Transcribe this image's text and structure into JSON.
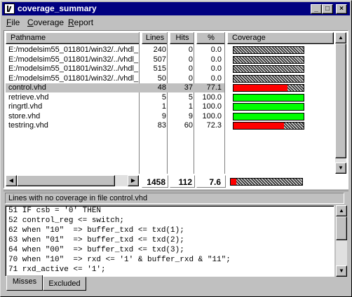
{
  "window": {
    "title": "coverage_summary"
  },
  "menu": [
    {
      "label": "File",
      "underline": "F",
      "rest": "ile"
    },
    {
      "label": "Coverage",
      "underline": "C",
      "rest": "overage"
    },
    {
      "label": "Report",
      "underline": "R",
      "rest": "eport"
    }
  ],
  "table": {
    "headers": {
      "pathname": "Pathname",
      "lines": "Lines",
      "hits": "Hits",
      "pct": "%",
      "coverage": "Coverage"
    },
    "rows": [
      {
        "path": "E:/modelsim55_011801/win32/../vhdl_",
        "lines": "240",
        "hits": "0",
        "pct": "0.0",
        "coverage": 0.0,
        "selected": false
      },
      {
        "path": "E:/modelsim55_011801/win32/../vhdl_",
        "lines": "507",
        "hits": "0",
        "pct": "0.0",
        "coverage": 0.0,
        "selected": false
      },
      {
        "path": "E:/modelsim55_011801/win32/../vhdl_",
        "lines": "515",
        "hits": "0",
        "pct": "0.0",
        "coverage": 0.0,
        "selected": false
      },
      {
        "path": "E:/modelsim55_011801/win32/../vhdl_",
        "lines": "50",
        "hits": "0",
        "pct": "0.0",
        "coverage": 0.0,
        "selected": false
      },
      {
        "path": "control.vhd",
        "lines": "48",
        "hits": "37",
        "pct": "77.1",
        "coverage": 77.1,
        "selected": true
      },
      {
        "path": "retrieve.vhd",
        "lines": "5",
        "hits": "5",
        "pct": "100.0",
        "coverage": 100.0,
        "selected": false
      },
      {
        "path": "ringrtl.vhd",
        "lines": "1",
        "hits": "1",
        "pct": "100.0",
        "coverage": 100.0,
        "selected": false
      },
      {
        "path": "store.vhd",
        "lines": "9",
        "hits": "9",
        "pct": "100.0",
        "coverage": 100.0,
        "selected": false
      },
      {
        "path": "testring.vhd",
        "lines": "83",
        "hits": "60",
        "pct": "72.3",
        "coverage": 72.3,
        "selected": false
      }
    ],
    "totals": {
      "lines": "1458",
      "hits": "112",
      "pct": "7.6",
      "coverage": 7.6
    }
  },
  "colors": {
    "full": "#00ff00",
    "partial": "#ff0000",
    "selection": "#c0c0c0",
    "titlebar": "#000080"
  },
  "bottom": {
    "title": "Lines with no coverage in file control.vhd",
    "lines": [
      "51 IF csb = '0' THEN",
      "52 control_reg <= switch;",
      "62 when \"10\"  => buffer_txd <= txd(1);",
      "63 when \"01\"  => buffer_txd <= txd(2);",
      "64 when \"00\"  => buffer_txd <= txd(3);",
      "70 when \"10\"  => rxd <= '1' & buffer_rxd & \"11\";",
      "71 rxd_active <= '1';"
    ]
  },
  "tabs": [
    {
      "label": "Misses",
      "active": true
    },
    {
      "label": "Excluded",
      "active": false
    }
  ]
}
